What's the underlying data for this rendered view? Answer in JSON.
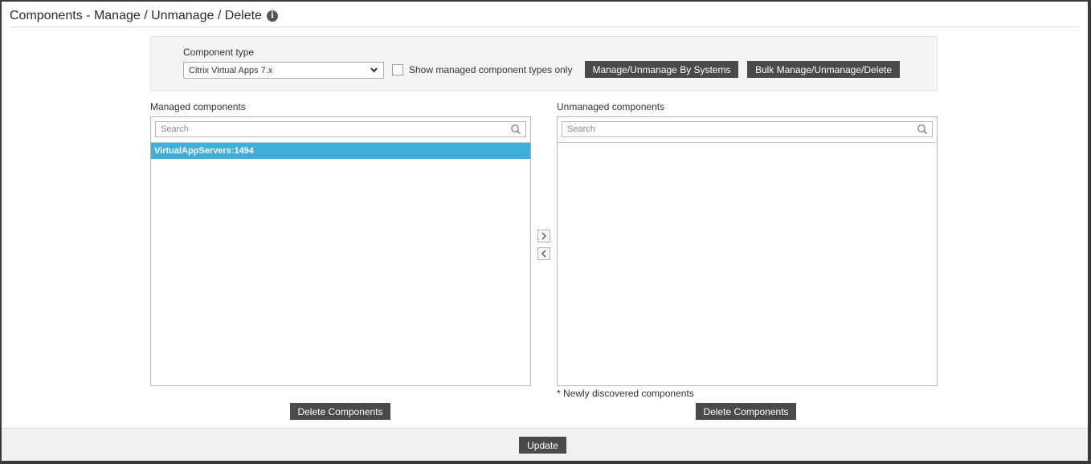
{
  "header": {
    "title": "Components - Manage / Unmanage / Delete",
    "info_icon": "info-icon"
  },
  "filter": {
    "component_type_label": "Component type",
    "component_type_value": "Citrix Virtual Apps 7.x",
    "show_managed_only_label": "Show managed component types only",
    "show_managed_only_checked": false,
    "manage_by_systems_label": "Manage/Unmanage By Systems",
    "bulk_label": "Bulk Manage/Unmanage/Delete"
  },
  "managed": {
    "label": "Managed components",
    "search_placeholder": "Search",
    "items": [
      {
        "label": "VirtualAppServers:1494",
        "selected": true
      }
    ],
    "delete_label": "Delete Components"
  },
  "unmanaged": {
    "label": "Unmanaged components",
    "search_placeholder": "Search",
    "items": [],
    "note": "* Newly discovered components",
    "delete_label": "Delete Components"
  },
  "transfer": {
    "move_right_icon": "chevron-right-icon",
    "move_left_icon": "chevron-left-icon"
  },
  "footer": {
    "update_label": "Update"
  },
  "colors": {
    "button": "#4a4a4a",
    "selected_row": "#3fb0dc",
    "panel": "#f4f4f4"
  }
}
